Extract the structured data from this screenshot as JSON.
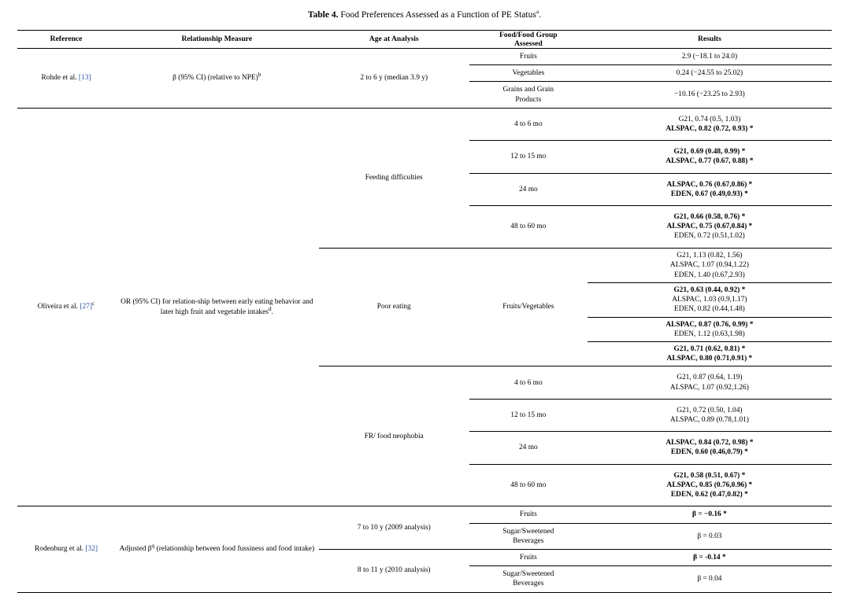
{
  "caption": {
    "label": "Table 4.",
    "text": "Food Preferences Assessed as a Function of PE Status",
    "footnote_marker": "a",
    "period": "."
  },
  "columns": {
    "reference": "Reference",
    "relationship_measure": "Relationship Measure",
    "age_at_analysis": "Age at Analysis",
    "food_group_line1": "Food/Food Group",
    "food_group_line2": "Assessed",
    "results": "Results"
  },
  "colors": {
    "citation_link": "#2a4fa2",
    "rule": "#000000",
    "page_background": "#ffffff"
  },
  "studies": [
    {
      "id": "rohde",
      "reference_author": "Rohde et al.",
      "reference_citation": "[13]",
      "reference_superscript": "",
      "measure_text": "β (95% CI) (relative to NPE)",
      "measure_superscript": "b",
      "age": "2 to 6 y (median 3.9 y)",
      "rows": [
        {
          "food": "Fruits",
          "result": "2.9 (−18.1 to 24.0)",
          "bold": false
        },
        {
          "food": "Vegetables",
          "result": "0.24 (−24.55 to 25.02)",
          "bold": false
        },
        {
          "food": "Grains and Grain\nProducts",
          "result": "−10.16 (−23.25 to 2.93)",
          "bold": false
        }
      ]
    },
    {
      "id": "oliveira",
      "reference_author": "Oliveira et al.",
      "reference_citation": "[27]",
      "reference_superscript": "c",
      "measure_text": "OR (95% CI) for relation-ship between early eating behavior and later high fruit and vegetable intakes",
      "measure_superscript": "d",
      "measure_period": ".",
      "food_group": "Fruits/Vegetables",
      "behaviors": [
        {
          "name": "Feeding difficulties",
          "ages": [
            {
              "age": "4 to 6 mo",
              "results": [
                {
                  "text": "G21, 0.74 (0.5, 1.03)",
                  "bold": false
                },
                {
                  "text": "ALSPAC, 0.82 (0.72, 0.93) *",
                  "bold": true
                }
              ]
            },
            {
              "age": "12 to 15 mo",
              "results": [
                {
                  "text": "G21, 0.69 (0.48, 0.99) *",
                  "bold": true
                },
                {
                  "text": "ALSPAC, 0.77 (0.67, 0.88) *",
                  "bold": true
                }
              ]
            },
            {
              "age": "24 mo",
              "results": [
                {
                  "text": "ALSPAC, 0.76 (0.67,0.86) *",
                  "bold": true
                },
                {
                  "text": "EDEN, 0.67 (0.49,0.93) *",
                  "bold": true
                }
              ]
            },
            {
              "age": "48 to 60 mo",
              "results": [
                {
                  "text": "G21, 0.66 (0.58, 0.76) *",
                  "bold": true
                },
                {
                  "text": "ALSPAC, 0.75 (0.67,0.84) *",
                  "bold": true
                },
                {
                  "text": "EDEN, 0.72 (0.51,1.02)",
                  "bold": false
                }
              ]
            }
          ]
        },
        {
          "name": "Poor eating",
          "ages": [
            {
              "age": "4 to 6 mo",
              "results": [
                {
                  "text": "G21, 1.13 (0.82, 1.56)",
                  "bold": false
                },
                {
                  "text": "ALSPAC, 1.07 (0.94,1.22)",
                  "bold": false
                },
                {
                  "text": "EDEN, 1.40 (0.67,2.93)",
                  "bold": false
                }
              ]
            },
            {
              "age": "12 to 15 mo",
              "results": [
                {
                  "text": "G21, 0.63 (0.44, 0.92) *",
                  "bold": true
                },
                {
                  "text": "ALSPAC, 1.03 (0.9,1.17)",
                  "bold": false
                },
                {
                  "text": "EDEN, 0.82 (0.44,1.48)",
                  "bold": false
                }
              ]
            },
            {
              "age": "24 mo",
              "results": [
                {
                  "text": "ALSPAC, 0.87 (0.76, 0.99) *",
                  "bold": true
                },
                {
                  "text": "EDEN, 1.12 (0.63,1.98)",
                  "bold": false
                }
              ]
            },
            {
              "age": "48 to 60 mo",
              "results": [
                {
                  "text": "G21, 0.71 (0.62, 0.81) *",
                  "bold": true
                },
                {
                  "text": "ALSPAC, 0.80 (0.71,0.91) *",
                  "bold": true
                }
              ]
            }
          ]
        },
        {
          "name": "FR/ food neophobia",
          "ages": [
            {
              "age": "4 to 6 mo",
              "results": [
                {
                  "text": "G21, 0.87 (0.64, 1.19)",
                  "bold": false
                },
                {
                  "text": "ALSPAC, 1.07 (0.92,1.26)",
                  "bold": false
                }
              ]
            },
            {
              "age": "12 to 15 mo",
              "results": [
                {
                  "text": "G21, 0.72 (0.50, 1.04)",
                  "bold": false
                },
                {
                  "text": "ALSPAC, 0.89 (0.78,1.01)",
                  "bold": false
                }
              ]
            },
            {
              "age": "24 mo",
              "results": [
                {
                  "text": "ALSPAC, 0.84 (0.72, 0.98) *",
                  "bold": true
                },
                {
                  "text": "EDEN, 0.60 (0.46,0.79) *",
                  "bold": true
                }
              ]
            },
            {
              "age": "48 to 60 mo",
              "results": [
                {
                  "text": "G21, 0.58 (0.51, 0.67) *",
                  "bold": true
                },
                {
                  "text": "ALSPAC, 0.85 (0.76,0.96) *",
                  "bold": true
                },
                {
                  "text": "EDEN, 0.62 (0.47,0.82) *",
                  "bold": true
                }
              ]
            }
          ]
        }
      ]
    },
    {
      "id": "rodenburg",
      "reference_author": "Rodenburg et al.",
      "reference_citation": "[32]",
      "reference_superscript": "",
      "measure_prefix": "Adjusted β",
      "measure_superscript": "q",
      "measure_text": " (relationship between food fussiness and food intake)",
      "analyses": [
        {
          "age": "7 to 10 y (2009 analysis)",
          "rows": [
            {
              "food": "Fruits",
              "result": "β = −0.16 *",
              "bold": true
            },
            {
              "food": "Sugar/Sweetened\nBeverages",
              "result": "β = 0.03",
              "bold": false
            }
          ]
        },
        {
          "age": "8 to 11 y (2010 analysis)",
          "rows": [
            {
              "food": "Fruits",
              "result": "β = -0.14 *",
              "bold": true
            },
            {
              "food": "Sugar/Sweetened\nBeverages",
              "result": "β = 0.04",
              "bold": false
            }
          ]
        }
      ]
    }
  ]
}
